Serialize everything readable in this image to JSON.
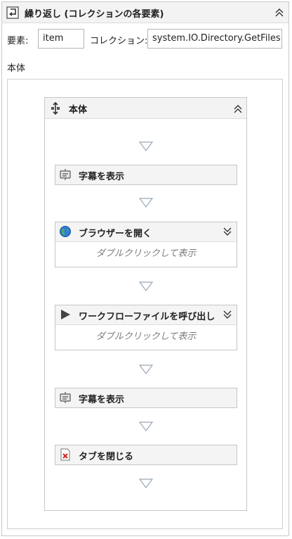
{
  "foreach": {
    "title": "繰り返し (コレクションの各要素)",
    "element_label": "要素:",
    "element_value": "item",
    "collection_label": "コレクション:",
    "collection_value": "system.IO.Directory.GetFiles",
    "body_label": "本体",
    "icon": "foreach-icon"
  },
  "sequence": {
    "title": "本体",
    "icon": "sequence-icon",
    "activities": [
      {
        "label": "字幕を表示",
        "icon": "message-icon",
        "expandable": false
      },
      {
        "label": "ブラウザーを開く",
        "icon": "globe-icon",
        "expandable": true,
        "body": "ダブルクリックして表示"
      },
      {
        "label": "ワークフローファイルを呼び出し",
        "icon": "play-icon",
        "expandable": true,
        "body": "ダブルクリックして表示"
      },
      {
        "label": "字幕を表示",
        "icon": "message-icon",
        "expandable": false
      },
      {
        "label": "タブを閉じる",
        "icon": "close-tab-icon",
        "expandable": false
      }
    ]
  }
}
